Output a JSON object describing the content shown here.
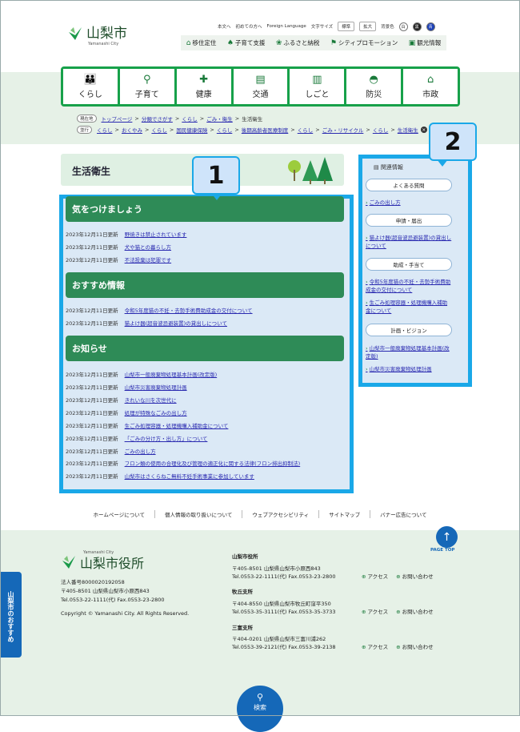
{
  "header": {
    "logo_name": "山梨市",
    "logo_en": "Yamanashi City",
    "utility": {
      "text_mode": "本文へ",
      "first_visit": "初めての方へ",
      "foreign": "Foreign Language",
      "font_size_label": "文字サイズ",
      "standard": "標準",
      "enlarge": "拡大",
      "bg_label": "背景色",
      "white": "白",
      "black": "黒",
      "blue": "青"
    },
    "sub_nav": [
      "移住定住",
      "子育て支援",
      "ふるさと納税",
      "シティプロモーション",
      "観光情報"
    ]
  },
  "main_nav": [
    "くらし",
    "子育て",
    "健康",
    "交通",
    "しごと",
    "防災",
    "市政"
  ],
  "breadcrumb1": {
    "tag": "現在地",
    "items": [
      "トップページ",
      "分類でさがす",
      "くらし",
      "ごみ・衛生"
    ],
    "current": "生活衛生"
  },
  "breadcrumb2": {
    "tag": "並行",
    "items": [
      "くらし",
      "おくやみ",
      "くらし",
      "国民健康保険",
      "くらし",
      "後期高齢者医療制度",
      "くらし",
      "ごみ・リサイクル",
      "くらし",
      "生活衛生"
    ]
  },
  "page_title": "生活衛生",
  "callouts": {
    "one": "1",
    "two": "2"
  },
  "sections": [
    {
      "title": "気をつけましょう",
      "items": [
        {
          "date": "2023年12月11日更新",
          "text": "野焼きは禁止されています"
        },
        {
          "date": "2023年12月11日更新",
          "text": "犬や猫との暮らし方"
        },
        {
          "date": "2023年12月11日更新",
          "text": "不法投棄は犯罪です"
        }
      ]
    },
    {
      "title": "おすすめ情報",
      "items": [
        {
          "date": "2023年12月11日更新",
          "text": "令和5年度猫の不妊・去勢手術費助成金の交付について"
        },
        {
          "date": "2023年12月11日更新",
          "text": "猫よけ器(超音波忌避装置)の貸出しについて"
        }
      ]
    },
    {
      "title": "お知らせ",
      "items": [
        {
          "date": "2023年12月11日更新",
          "text": "山梨市一般廃棄物処理基本計画(改定版)"
        },
        {
          "date": "2023年12月11日更新",
          "text": "山梨市災害廃棄物処理計画"
        },
        {
          "date": "2023年12月11日更新",
          "text": "きれいな川を次世代に"
        },
        {
          "date": "2023年12月11日更新",
          "text": "処理が特殊なごみの出し方"
        },
        {
          "date": "2023年12月11日更新",
          "text": "生ごみ処理容器・処理機購入補助金について"
        },
        {
          "date": "2023年12月11日更新",
          "text": "「ごみの分け方・出し方」について"
        },
        {
          "date": "2023年12月11日更新",
          "text": "ごみの出し方"
        },
        {
          "date": "2023年12月11日更新",
          "text": "フロン類の使用の合理化及び管理の適正化に関する法律(フロン排出抑制法)"
        },
        {
          "date": "2023年12月11日更新",
          "text": "山梨市はさくらねこ無料不妊手術事業に参加しています"
        }
      ]
    }
  ],
  "sidebar": {
    "heading": "関連情報",
    "groups": [
      {
        "label": "よくある質問",
        "links": [
          "ごみの出し方"
        ]
      },
      {
        "label": "申請・届出",
        "links": [
          "猫よけ器(超音波忌避装置)の貸出しについて"
        ]
      },
      {
        "label": "助成・手当て",
        "links": [
          "令和5年度猫の不妊・去勢手術費助成金の交付について",
          "生ごみ処理容器・処理機購入補助金について"
        ]
      },
      {
        "label": "計画・ビジョン",
        "links": [
          "山梨市一般廃棄物処理基本計画(改定版)",
          "山梨市災害廃棄物処理計画"
        ]
      }
    ]
  },
  "footer_nav": [
    "ホームページについて",
    "個人情報の取り扱いについて",
    "ウェブアクセシビリティ",
    "サイトマップ",
    "バナー広告について"
  ],
  "page_top": "PAGE TOP",
  "footer": {
    "logo_en": "Yamanashi City",
    "logo_name": "山梨市役所",
    "corp_no": "法人番号8000020192058",
    "address": "〒405-8501 山梨県山梨市小原西843",
    "tel": "Tel.0553-22-1111(代) Fax.0553-23-2800",
    "copyright": "Copyright © Yamanashi City. All Rights Reserved.",
    "offices": [
      {
        "name": "山梨市役所",
        "address": "〒405-8501 山梨県山梨市小原西843",
        "tel": "Tel.0553-22-1111(代) Fax.0553-23-2800"
      },
      {
        "name": "牧丘支所",
        "address": "〒404-8550 山梨県山梨市牧丘町窪平350",
        "tel": "Tel.0553-35-3111(代) Fax.0553-35-3733"
      },
      {
        "name": "三富支所",
        "address": "〒404-0201 山梨県山梨市三富川浦262",
        "tel": "Tel.0553-39-2121(代) Fax.0553-39-2138"
      }
    ],
    "access": "アクセス",
    "contact": "お問い合わせ"
  },
  "side_tab": "山梨市のおすすめ",
  "search": "検索"
}
